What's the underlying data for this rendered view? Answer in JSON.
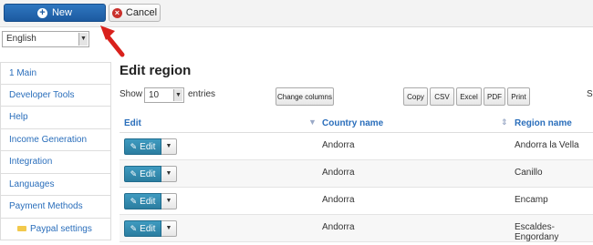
{
  "toolbar": {
    "new_label": "New",
    "cancel_label": "Cancel"
  },
  "language": {
    "selected": "English"
  },
  "sidebar": {
    "items": [
      {
        "label": "1 Main"
      },
      {
        "label": "Developer Tools"
      },
      {
        "label": "Help"
      },
      {
        "label": "Income Generation"
      },
      {
        "label": "Integration"
      },
      {
        "label": "Languages"
      },
      {
        "label": "Payment Methods"
      }
    ],
    "sub_items": [
      {
        "label": "Paypal settings"
      }
    ]
  },
  "page": {
    "title": "Edit region"
  },
  "table_controls": {
    "show_label": "Show",
    "show_value": "10",
    "entries_label": "entries",
    "change_columns": "Change columns",
    "export_buttons": [
      "Copy",
      "CSV",
      "Excel",
      "PDF",
      "Print"
    ],
    "search_cut": "Se"
  },
  "table": {
    "headers": {
      "edit": "Edit",
      "country": "Country name",
      "region": "Region name"
    },
    "edit_label": "Edit",
    "rows": [
      {
        "country": "Andorra",
        "region": "Andorra la Vella"
      },
      {
        "country": "Andorra",
        "region": "Canillo"
      },
      {
        "country": "Andorra",
        "region": "Encamp"
      },
      {
        "country": "Andorra",
        "region": "Escaldes-Engordany"
      }
    ]
  },
  "colors": {
    "primary": "#1c5aa0",
    "edit_button": "#2b7da0",
    "link": "#2a6ebb",
    "arrow": "#d9211c"
  }
}
